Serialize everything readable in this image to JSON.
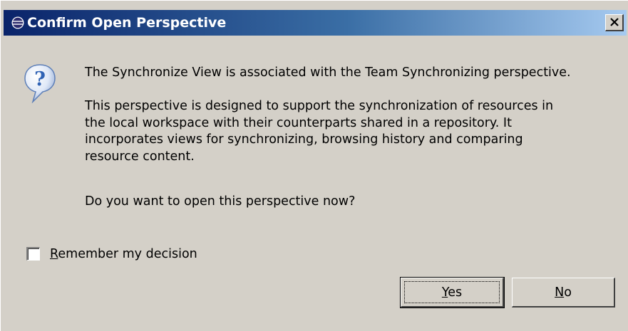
{
  "dialog": {
    "title": "Confirm Open Perspective",
    "icons": {
      "title": "eclipse-icon",
      "close": "close-icon",
      "message": "question-icon"
    },
    "message_line1": "The Synchronize View is associated with the Team Synchronizing perspective.",
    "message_body": [
      "This perspective is designed to support the synchronization of resources in",
      "the local workspace with their counterparts shared in a repository. It",
      "incorporates views for synchronizing, browsing history and comparing",
      "resource content."
    ],
    "question": "Do you want to open this perspective now?",
    "remember": {
      "mnemonic": "R",
      "rest": "emember my decision",
      "checked": false
    },
    "buttons": {
      "yes": {
        "mnemonic": "Y",
        "rest": "es"
      },
      "no": {
        "mnemonic": "N",
        "rest": "o"
      }
    }
  },
  "colors": {
    "dialog_bg": "#d4d0c8",
    "titlebar_start": "#0a246a",
    "titlebar_end": "#a6caf0",
    "question_icon": "#2f62b4"
  }
}
